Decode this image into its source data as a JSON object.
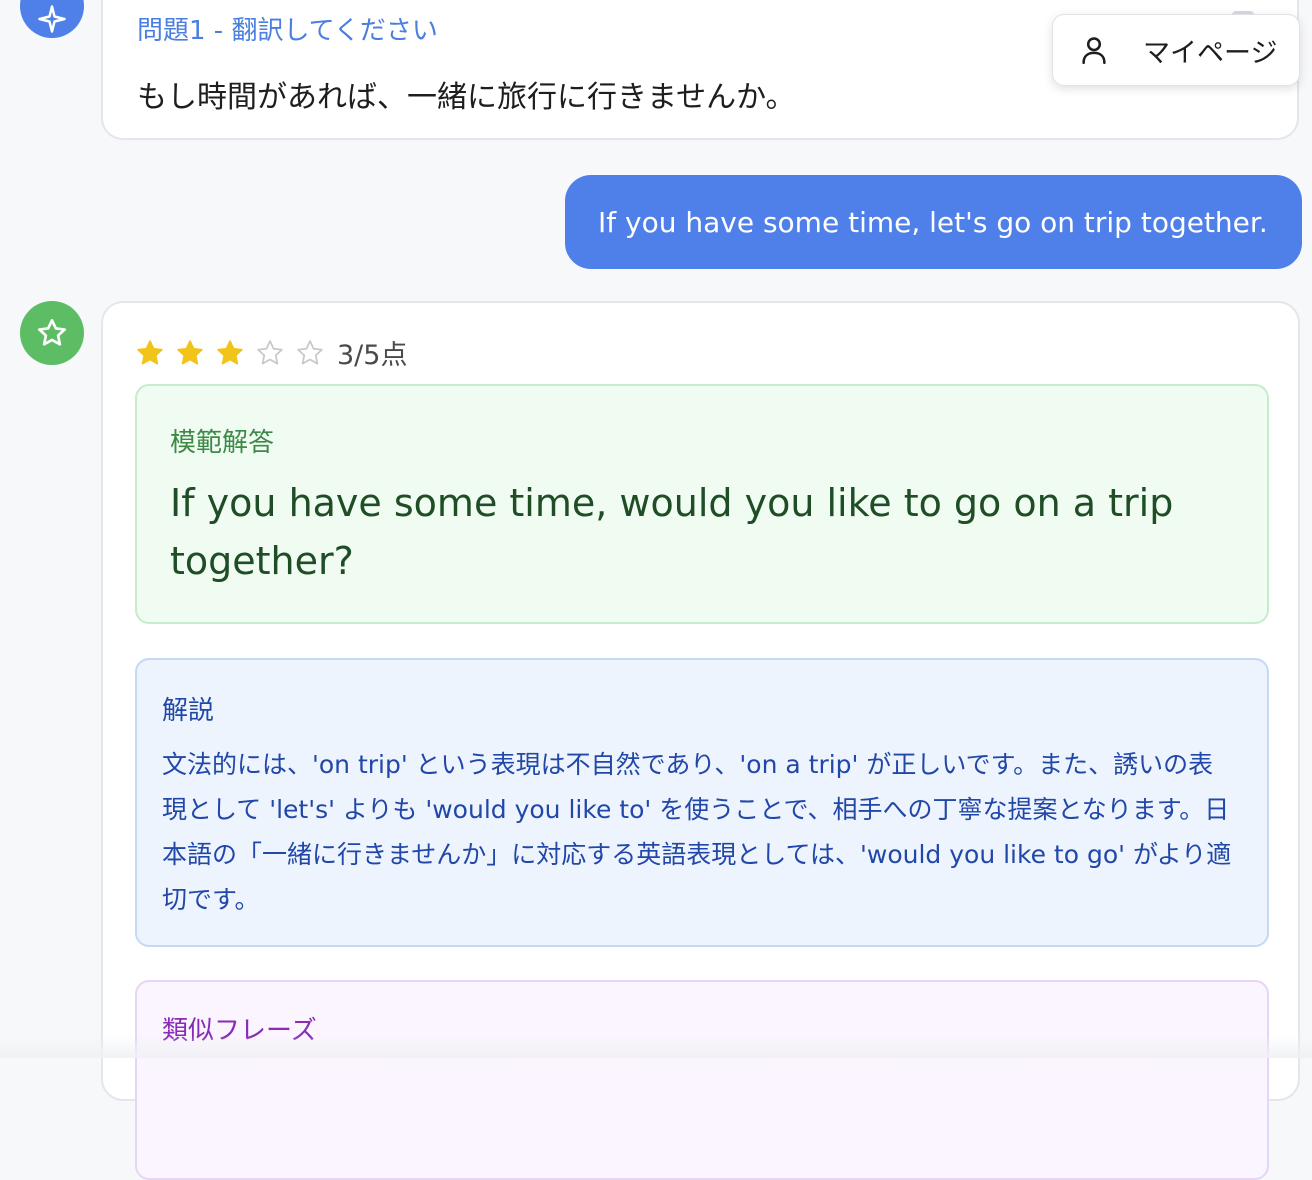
{
  "question": {
    "label": "問題1 - 翻訳してください",
    "text": "もし時間があれば、一緒に旅行に行きませんか。",
    "avatar_icon": "sparkle-icon"
  },
  "header": {
    "mypage_label": "マイページ",
    "mypage_icon": "user-icon"
  },
  "user_answer": {
    "text": "If you have some time, let's go on trip together."
  },
  "result": {
    "avatar_icon": "star-icon",
    "rating": {
      "score": 3,
      "max": 5
    },
    "score_text": "3/5点",
    "model_answer": {
      "label": "模範解答",
      "text": "If you have some time, would you like to go on a trip together?"
    },
    "explanation": {
      "label": "解説",
      "text": "文法的には、'on trip' という表現は不自然であり、'on a trip' が正しいです。また、誘いの表現として 'let's' よりも 'would you like to' を使うことで、相手への丁寧な提案となります。日本語の「一緒に行きませんか」に対応する英語表現としては、'would you like to go' がより適切です。"
    },
    "similar_phrases": {
      "label": "類似フレーズ"
    }
  },
  "colors": {
    "accent_blue": "#4f7fe8",
    "grade_green": "#5cbd64",
    "star_filled": "#f2c318",
    "star_empty": "#c8c8c8"
  }
}
